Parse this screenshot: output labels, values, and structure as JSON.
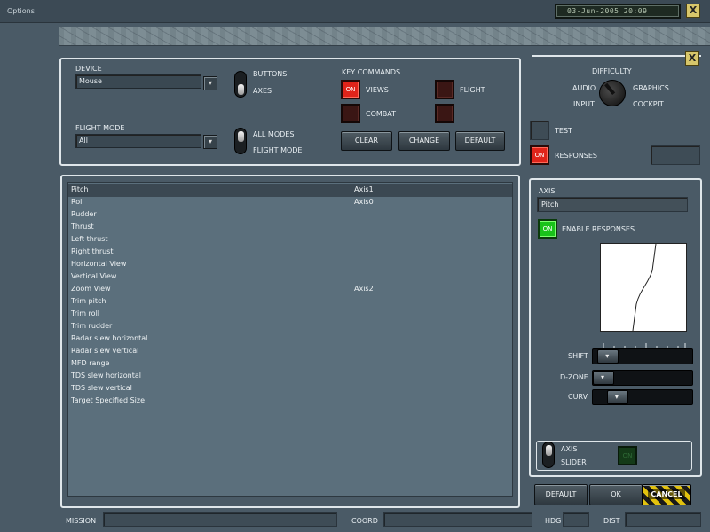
{
  "window": {
    "title": "Options",
    "clock": "03-Jun-2005    20:09",
    "close_label": "X"
  },
  "controls_panel": {
    "device_label": "DEVICE",
    "device_value": "Mouse",
    "flight_mode_label": "FLIGHT MODE",
    "flight_mode_value": "All",
    "toggle1": {
      "top_label": "BUTTONS",
      "bottom_label": "AXES"
    },
    "toggle2": {
      "top_label": "ALL MODES",
      "bottom_label": "FLIGHT MODE"
    },
    "key_commands": {
      "title": "KEY COMMANDS",
      "views_label": "VIEWS",
      "views_state": "ON",
      "flight_label": "FLIGHT",
      "combat_label": "COMBAT"
    },
    "buttons": {
      "clear": "CLEAR",
      "change": "CHANGE",
      "default": "DEFAULT"
    }
  },
  "axis_list": {
    "rows": [
      {
        "name": "Pitch",
        "axis": "Axis1",
        "selected": true
      },
      {
        "name": "Roll",
        "axis": "Axis0"
      },
      {
        "name": "Rudder",
        "axis": ""
      },
      {
        "name": "Thrust",
        "axis": ""
      },
      {
        "name": "Left thrust",
        "axis": ""
      },
      {
        "name": "Right thrust",
        "axis": ""
      },
      {
        "name": "Horizontal View",
        "axis": ""
      },
      {
        "name": "Vertical View",
        "axis": ""
      },
      {
        "name": "Zoom View",
        "axis": "Axis2"
      },
      {
        "name": "Trim pitch",
        "axis": ""
      },
      {
        "name": "Trim roll",
        "axis": ""
      },
      {
        "name": "Trim rudder",
        "axis": ""
      },
      {
        "name": "Radar slew horizontal",
        "axis": ""
      },
      {
        "name": "Radar slew vertical",
        "axis": ""
      },
      {
        "name": "MFD range",
        "axis": ""
      },
      {
        "name": "TDS slew horizontal",
        "axis": ""
      },
      {
        "name": "TDS slew vertical",
        "axis": ""
      },
      {
        "name": "Target Specified Size",
        "axis": ""
      }
    ]
  },
  "right_panel": {
    "close_label": "X",
    "difficulty": {
      "title": "DIFFICULTY",
      "audio": "AUDIO",
      "graphics": "GRAPHICS",
      "input": "INPUT",
      "cockpit": "COCKPIT"
    },
    "test_label": "TEST",
    "responses_label": "RESPONSES",
    "responses_state": "ON"
  },
  "axis_panel": {
    "title": "AXIS",
    "axis_name": "Pitch",
    "enable_state": "ON",
    "enable_label": "ENABLE RESPONSES",
    "shift_label": "SHIFT",
    "dzone_label": "D-ZONE",
    "curv_label": "CURV",
    "shift_level": 0.06,
    "dzone_level": 0.0,
    "curv_level": 0.18,
    "axis_toggle_label": "AXIS",
    "slider_toggle_label": "SLIDER",
    "slider_button_label": "ON"
  },
  "bottom_buttons": {
    "default": "DEFAULT",
    "ok": "OK",
    "cancel": "CANCEL"
  },
  "footer": {
    "mission": "MISSION",
    "coord": "COORD",
    "hdg": "HDG",
    "dist": "DIST"
  },
  "colors": {
    "background": "#4a5a66",
    "accent_red": "#e0241a",
    "accent_green": "#19c21a",
    "hazard_yellow": "#e2c20e"
  }
}
